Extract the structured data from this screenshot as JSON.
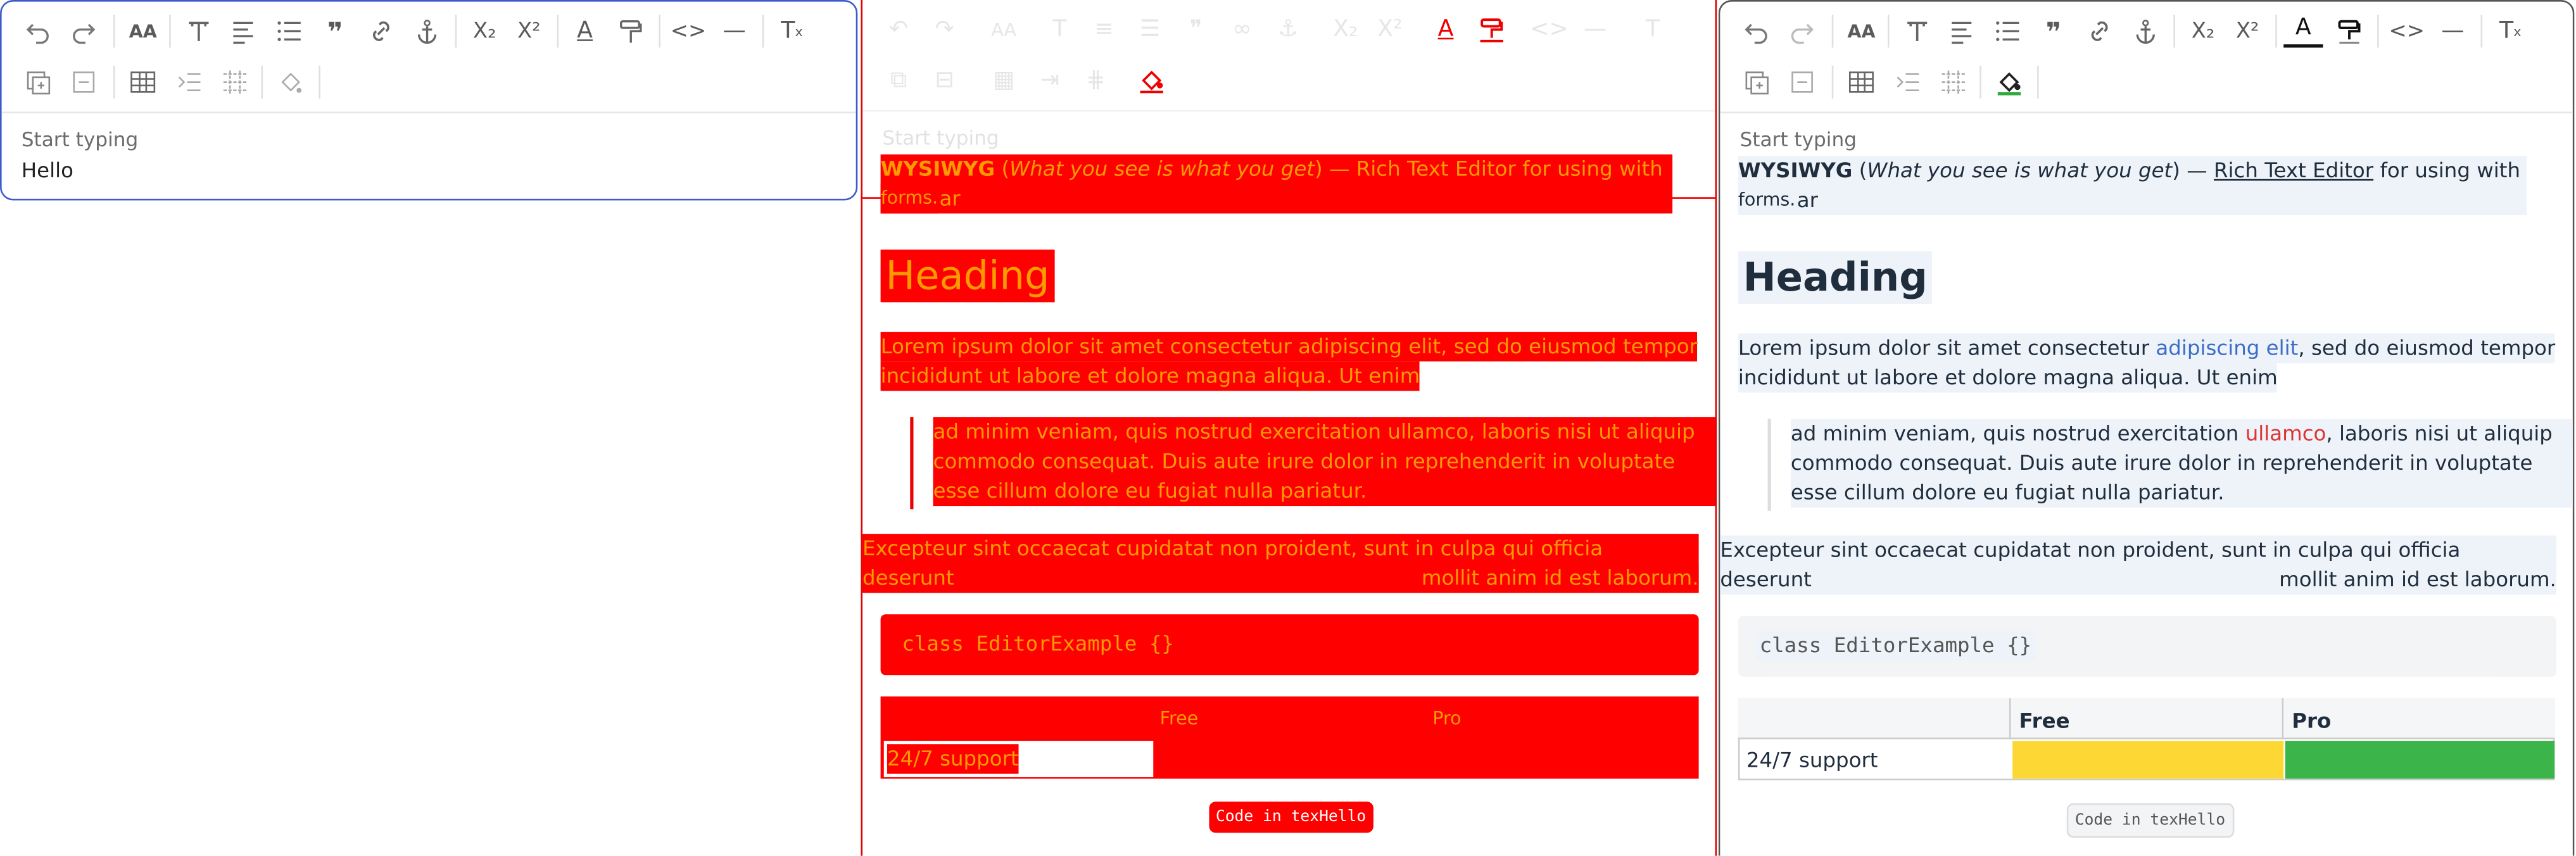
{
  "placeholder": "Start typing",
  "left": {
    "value": "Hello"
  },
  "content": {
    "p1_bold": "WYSIWYG",
    "p1_open": " (",
    "p1_em": "What you see is what you get",
    "p1_mid": ") — ",
    "p1_link": "Rich Text Editor",
    "p1_tail": " for using with Angular",
    "p1_small": "forms.",
    "heading": "Heading",
    "p2_a": "Lorem ipsum dolor sit amet consectetur ",
    "p2_link": "adipiscing elit",
    "p2_b": ", sed do eiusmod tempor",
    "p2_c": "incididunt ut labore et dolore magna aliqua. Ut enim",
    "q1_a": "ad minim veniam, quis nostrud exercitation ",
    "q1_mark": "ullamco",
    "q1_b": ", laboris nisi ut aliquip ex ea",
    "q2": "commodo consequat. Duis aute irure dolor in reprehenderit in voluptate velit",
    "q3": "esse cillum dolore eu fugiat nulla pariatur.",
    "r1": "Excepteur sint occaecat cupidatat non proident, sunt in culpa qui officia deserunt",
    "r2": "mollit anim id est laborum.",
    "code": "class EditorExample {}",
    "table": {
      "h1": "Free",
      "h2": "Pro",
      "row": "24/7 support"
    },
    "inline_code": "Code in texHello"
  },
  "colors": {
    "accent": "#3d5bc9",
    "red": "#ff0000",
    "orange": "#ff9a00",
    "yellow": "#fdd835",
    "green": "#3bb54a"
  },
  "icons": [
    "undo-icon",
    "redo-icon",
    "font-size-icon",
    "font-icon",
    "align-icon",
    "list-icon",
    "quote-icon",
    "link-icon",
    "anchor-icon",
    "subscript-icon",
    "superscript-icon",
    "text-color-icon",
    "paint-roller-icon",
    "code-icon",
    "horizontal-rule-icon",
    "clear-format-icon",
    "insert-image-icon",
    "delete-icon",
    "table-icon",
    "indent-icon",
    "split-icon",
    "fill-icon"
  ]
}
